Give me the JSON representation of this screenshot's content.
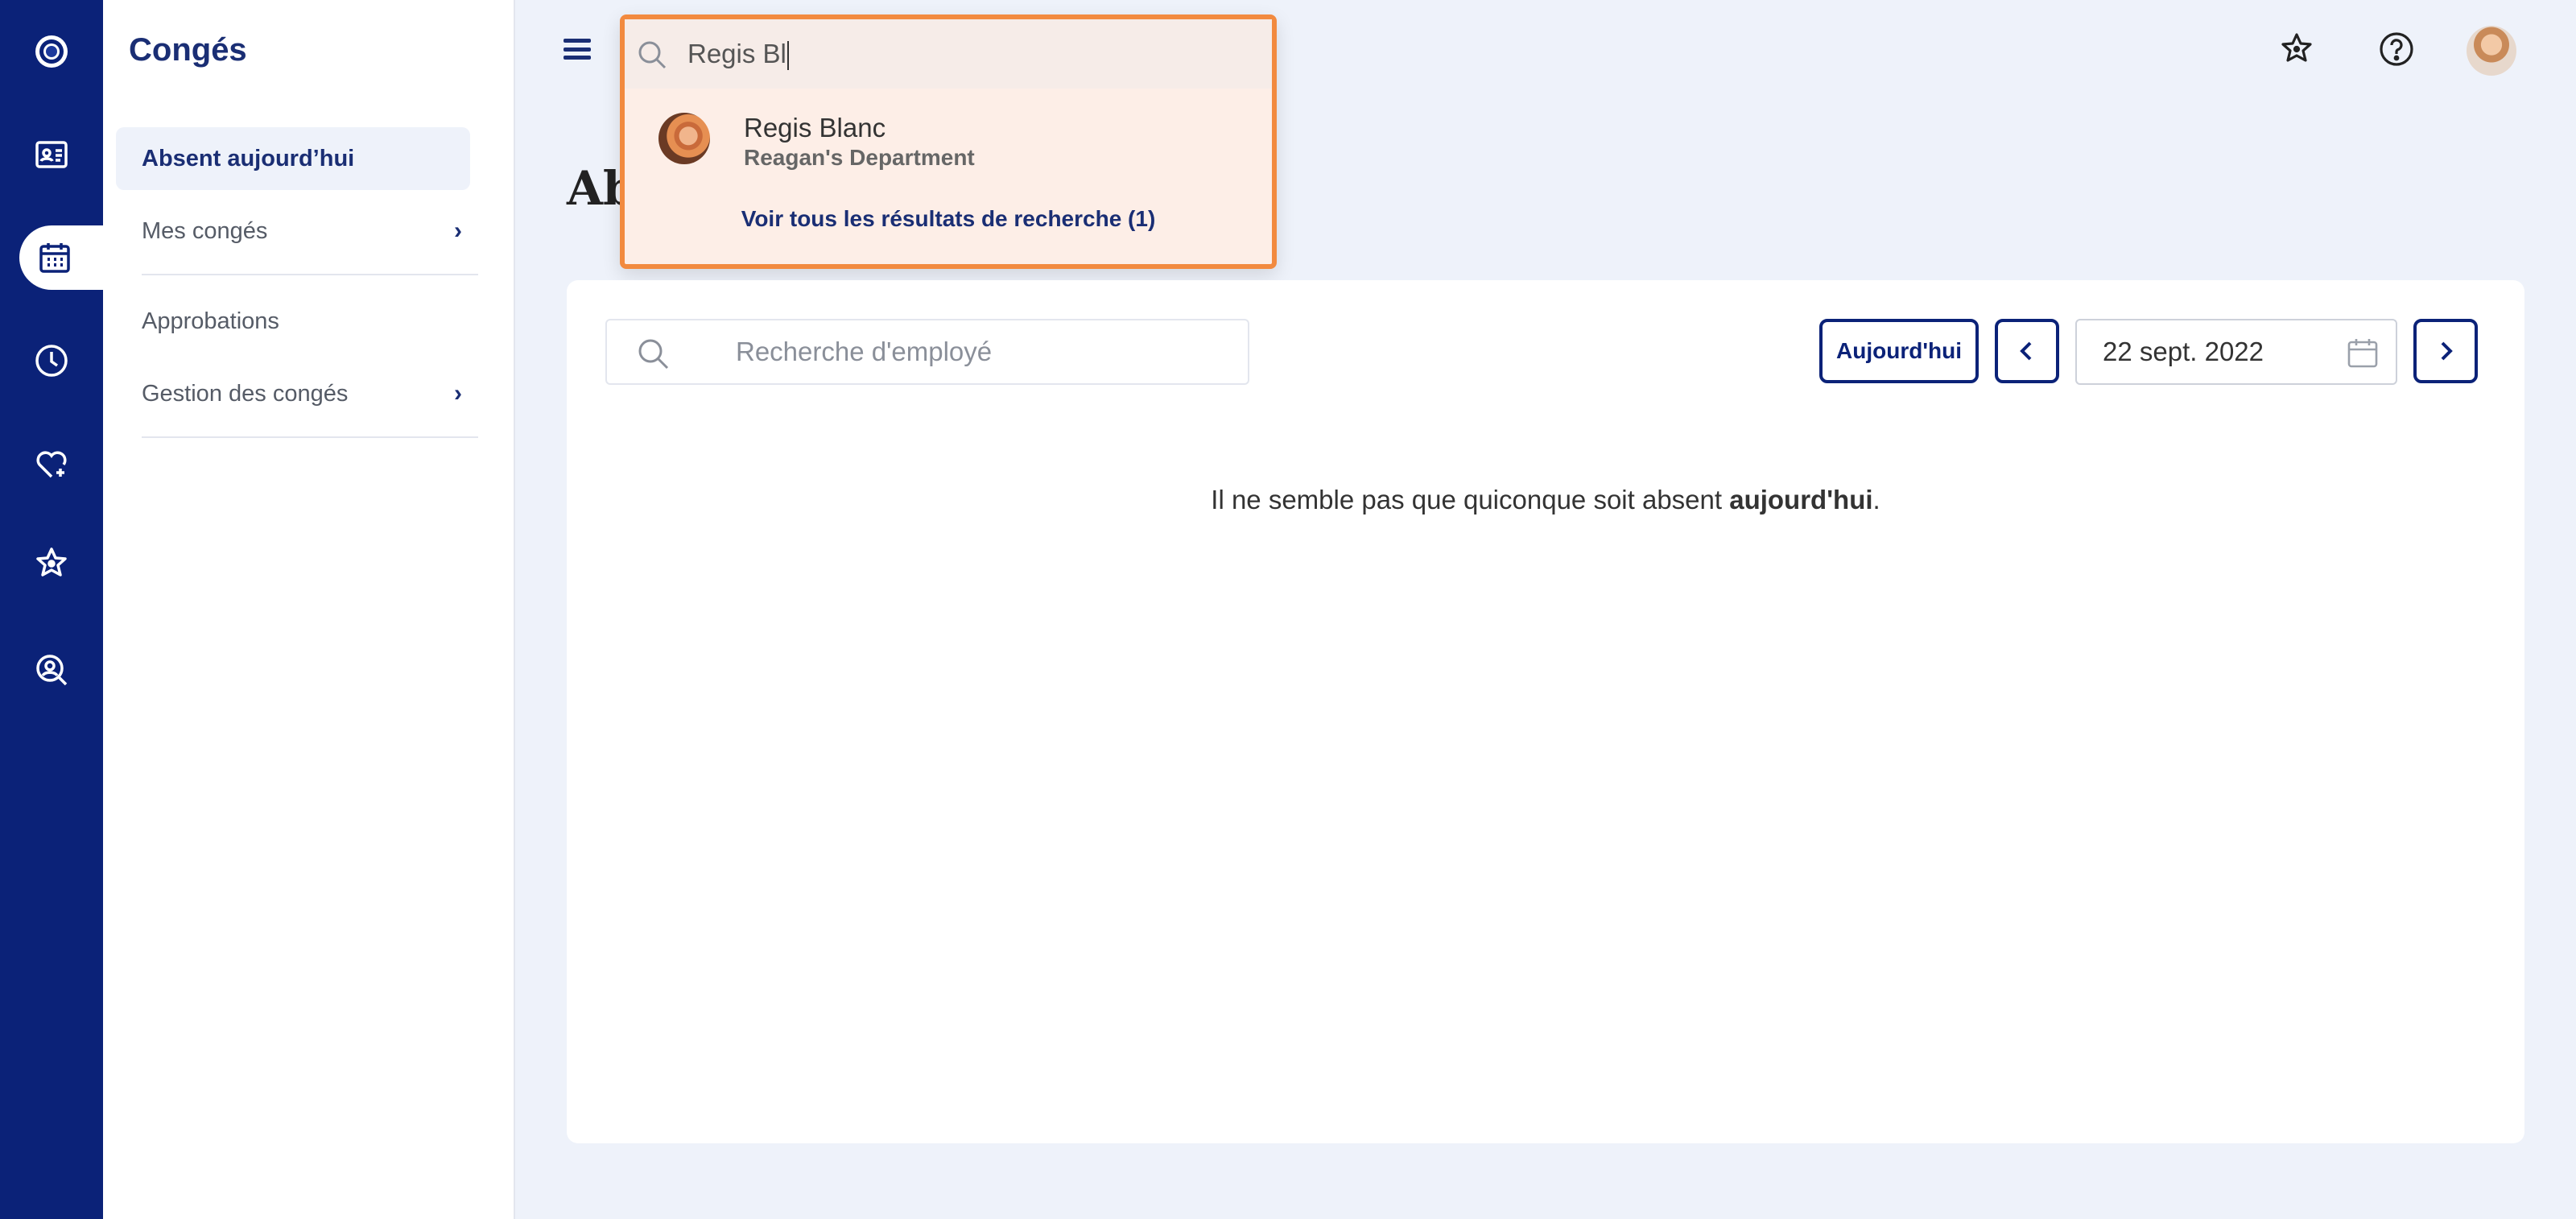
{
  "sidebar": {
    "title": "Congés",
    "items": [
      {
        "label": "Absent aujourd’hui",
        "active": true,
        "chevron": ""
      },
      {
        "label": "Mes congés",
        "active": false,
        "chevron": "›"
      },
      {
        "label": "Approbations",
        "active": false,
        "chevron": ""
      },
      {
        "label": "Gestion des congés",
        "active": false,
        "chevron": "›"
      }
    ]
  },
  "rail": {
    "icons": [
      "logo-icon",
      "id-card-icon",
      "calendar-icon",
      "clock-icon",
      "heart-plus-icon",
      "star-badge-icon",
      "person-search-icon"
    ],
    "active": "calendar-icon"
  },
  "header": {
    "page_title_visible": "Ab",
    "icons": [
      "star-badge-icon",
      "help-icon",
      "user-avatar"
    ]
  },
  "global_search": {
    "value": "Regis Bl",
    "result": {
      "name": "Regis Blanc",
      "department": "Reagan's Department"
    },
    "see_all": "Voir tous les résultats de recherche (1)"
  },
  "absences": {
    "search_placeholder": "Recherche d'employé",
    "today_button": "Aujourd'hui",
    "date": "22 sept. 2022",
    "empty_prefix": "Il ne semble pas que quiconque soit absent ",
    "empty_bold": "aujourd'hui",
    "empty_suffix": "."
  },
  "colors": {
    "brand": "#0b2278",
    "search_highlight": "#f28a3f",
    "background": "#eef2fa"
  }
}
